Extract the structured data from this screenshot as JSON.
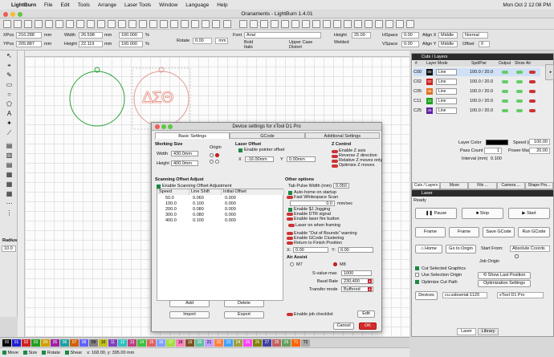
{
  "menubar": {
    "app": "LightBurn",
    "items": [
      "File",
      "Edit",
      "Tools",
      "Arrange",
      "Laser Tools",
      "Window",
      "Language",
      "Help"
    ],
    "clock": "Mon Oct 2  12:08 PM"
  },
  "window": {
    "title": "Oranaments - LightBurn 1.4.01"
  },
  "numedit": {
    "xpos_label": "XPos",
    "xpos": "216.288",
    "ypos_label": "YPos",
    "ypos": "205.887",
    "unit": "mm",
    "width_label": "Width",
    "width": "26.598",
    "height_label": "Height",
    "height": "22.119",
    "pct_w": "100.000",
    "pct_h": "100.000",
    "pct": "%",
    "rotate_label": "Rotate",
    "rotate": "0.00",
    "rotate_unit": "mm",
    "font_label": "Font",
    "font": "Arial",
    "height2_label": "Height",
    "height2": "25.00",
    "hspace_label": "HSpace",
    "hspace": "0.00",
    "vspace_label": "VSpace",
    "vspace": "0.00",
    "aligny_label": "Align Y",
    "aligny": "Middle",
    "alignx_label": "Align X",
    "alignx": "Middle",
    "offset_label": "Offset",
    "offset": "0",
    "normal": "Normal",
    "bold": "Bold",
    "italic": "Italic",
    "upper": "Upper Case",
    "distort": "Distort",
    "welded": "Welded"
  },
  "canvas": {
    "ornament_text": "ΔΣΘ"
  },
  "palette": [
    "00",
    "01",
    "02",
    "03",
    "04",
    "05",
    "06",
    "07",
    "08",
    "09",
    "10",
    "11",
    "12",
    "13",
    "14",
    "15",
    "16",
    "17",
    "18",
    "19",
    "20",
    "21",
    "22",
    "23",
    "24",
    "25",
    "26",
    "27",
    "28",
    "29",
    "T1",
    "T2"
  ],
  "palette_colors": [
    "#000000",
    "#2020d0",
    "#d02020",
    "#20a020",
    "#d0a000",
    "#a020a0",
    "#20a0a0",
    "#d06000",
    "#6060ff",
    "#7f7f7f",
    "#c0c020",
    "#8040c0",
    "#30c0c0",
    "#c04080",
    "#40c040",
    "#e06060",
    "#80a0ff",
    "#a0e040",
    "#ff80c0",
    "#805020",
    "#60c0a0",
    "#c0a0ff",
    "#ff8040",
    "#40a0ff",
    "#a0a040",
    "#ff40ff",
    "#808000",
    "#4040a0",
    "#c06060",
    "#60a060",
    "#ff6000",
    "#aaaaaa"
  ],
  "status": {
    "move": "Move",
    "size": "Size",
    "rotate": "Rotate",
    "shear": "Shear",
    "coords": "x: 168.00, y: 395.00 mm"
  },
  "cuts": {
    "header": "Cuts / Layers",
    "cols": [
      "#",
      "Layer",
      "Mode",
      "Spd/Pwr",
      "Output",
      "Show",
      "Air"
    ],
    "rows": [
      {
        "id": "C00",
        "num": "00",
        "color": "#111111",
        "mode": "Line",
        "sp": "100.0 / 20.0"
      },
      {
        "id": "C02",
        "num": "02",
        "color": "#cc2020",
        "mode": "Line",
        "sp": "100.0 / 20.0"
      },
      {
        "id": "C05",
        "num": "05",
        "color": "#e07020",
        "mode": "Line",
        "sp": "100.0 / 20.0"
      },
      {
        "id": "C11",
        "num": "11",
        "color": "#20a020",
        "mode": "Line",
        "sp": "100.0 / 20.0"
      },
      {
        "id": "C25",
        "num": "25",
        "color": "#6020a0",
        "mode": "Line",
        "sp": "100.0 / 20.0"
      }
    ],
    "layer_color": "Layer Color",
    "speed_label": "Speed (mm/s)",
    "speed": "100.00",
    "pass_label": "Pass Count",
    "pass": "1",
    "power_label": "Power Max (%)",
    "power": "20.00",
    "interval_label": "Interval (mm)",
    "interval": "0.100"
  },
  "tabs_bottom": [
    "Cuts / Layers",
    "Move",
    "File ...",
    "Camera ...",
    "Shape Pro..."
  ],
  "laser": {
    "header": "Laser",
    "status": "Ready",
    "pause": "Pause",
    "stop": "Stop",
    "start": "Start",
    "frame1": "Frame",
    "frame2": "Frame",
    "save_gcode": "Save GCode",
    "run_gcode": "Run GCode",
    "home": "Home",
    "go_origin": "Go to Origin",
    "start_from_label": "Start From:",
    "start_from": "Absolute Coords",
    "job_origin": "Job Origin",
    "cut_selected": "Cut Selected Graphics",
    "use_selection": "Use Selection Origin",
    "optimize": "Optimize Cut Path",
    "show_last": "Show Last Position",
    "opt_settings": "Optimization Settings",
    "devices": "Devices",
    "port": "cu.usbserial-1120",
    "device": "xTool D1 Pro",
    "tab_laser": "Laser",
    "tab_library": "Library"
  },
  "dialog": {
    "title": "Device settings for xTool D1 Pro",
    "tabs": [
      "Basic Settings",
      "GCode",
      "Additional Settings"
    ],
    "working_size": "Working Size",
    "width_label": "Width",
    "width": "430.0mm",
    "height_label": "Height",
    "height": "400.0mm",
    "origin": "Origin",
    "laser_offset": "Laser Offset",
    "enable_pointer": "Enable pointer offset",
    "x_label": "X",
    "x": "-16.00mm",
    "y_label": "Y",
    "y": "0.00mm",
    "zcontrol": "Z Control",
    "enable_z": "Enable Z axis",
    "reverse_z": "Reverse Z direction",
    "relative_z": "Relative Z moves only",
    "optimize_z": "Optimize Z moves",
    "scan_adjust": "Scanning Offset Adjust",
    "enable_scan": "Enable Scanning Offset Adjustment",
    "scan_cols": [
      "Speed",
      "Line Shift",
      "Initial Offset"
    ],
    "scan_rows": [
      [
        "50.0",
        "0.060",
        "0.000"
      ],
      [
        "100.0",
        "0.100",
        "0.000"
      ],
      [
        "200.0",
        "0.080",
        "0.000"
      ],
      [
        "300.0",
        "0.080",
        "0.000"
      ],
      [
        "400.0",
        "0.100",
        "0.000"
      ]
    ],
    "add": "Add",
    "delete": "Delete",
    "import": "Import",
    "export": "Export",
    "other": "Other options",
    "tab_pulse": "Tab Pulse Width (mm)",
    "tab_pulse_val": "0.050",
    "auto_home": "Auto-home on startup",
    "fast_ws": "Fast Whitespace Scan",
    "fast_ws_val": "0.0",
    "fast_ws_unit": "mm/sec",
    "enable_jog": "Enable $J Jogging",
    "enable_dtr": "Enable DTR signal",
    "enable_fire": "Enable laser fire button",
    "laser_framing": "Laser on when framing",
    "oob": "Enable \"Out of Bounds\" warning",
    "gcode_cluster": "Enable GCode Clustering",
    "return_finish": "Return to Finish Position",
    "fx_label": "X:",
    "fx": "0.00",
    "fy_label": "Y:",
    "fy": "0.00",
    "air": "Air Assist",
    "m7": "M7",
    "m8": "M8",
    "svalue_label": "S-value max",
    "svalue": "1000",
    "baud_label": "Baud Rate",
    "baud": "230,400",
    "transfer_label": "Transfer mode",
    "transfer": "Buffered",
    "job_checklist": "Enable job checklist",
    "edit": "Edit",
    "cancel": "Cancel",
    "ok": "OK"
  },
  "radius": {
    "label": "Radius:",
    "value": "10.0"
  }
}
